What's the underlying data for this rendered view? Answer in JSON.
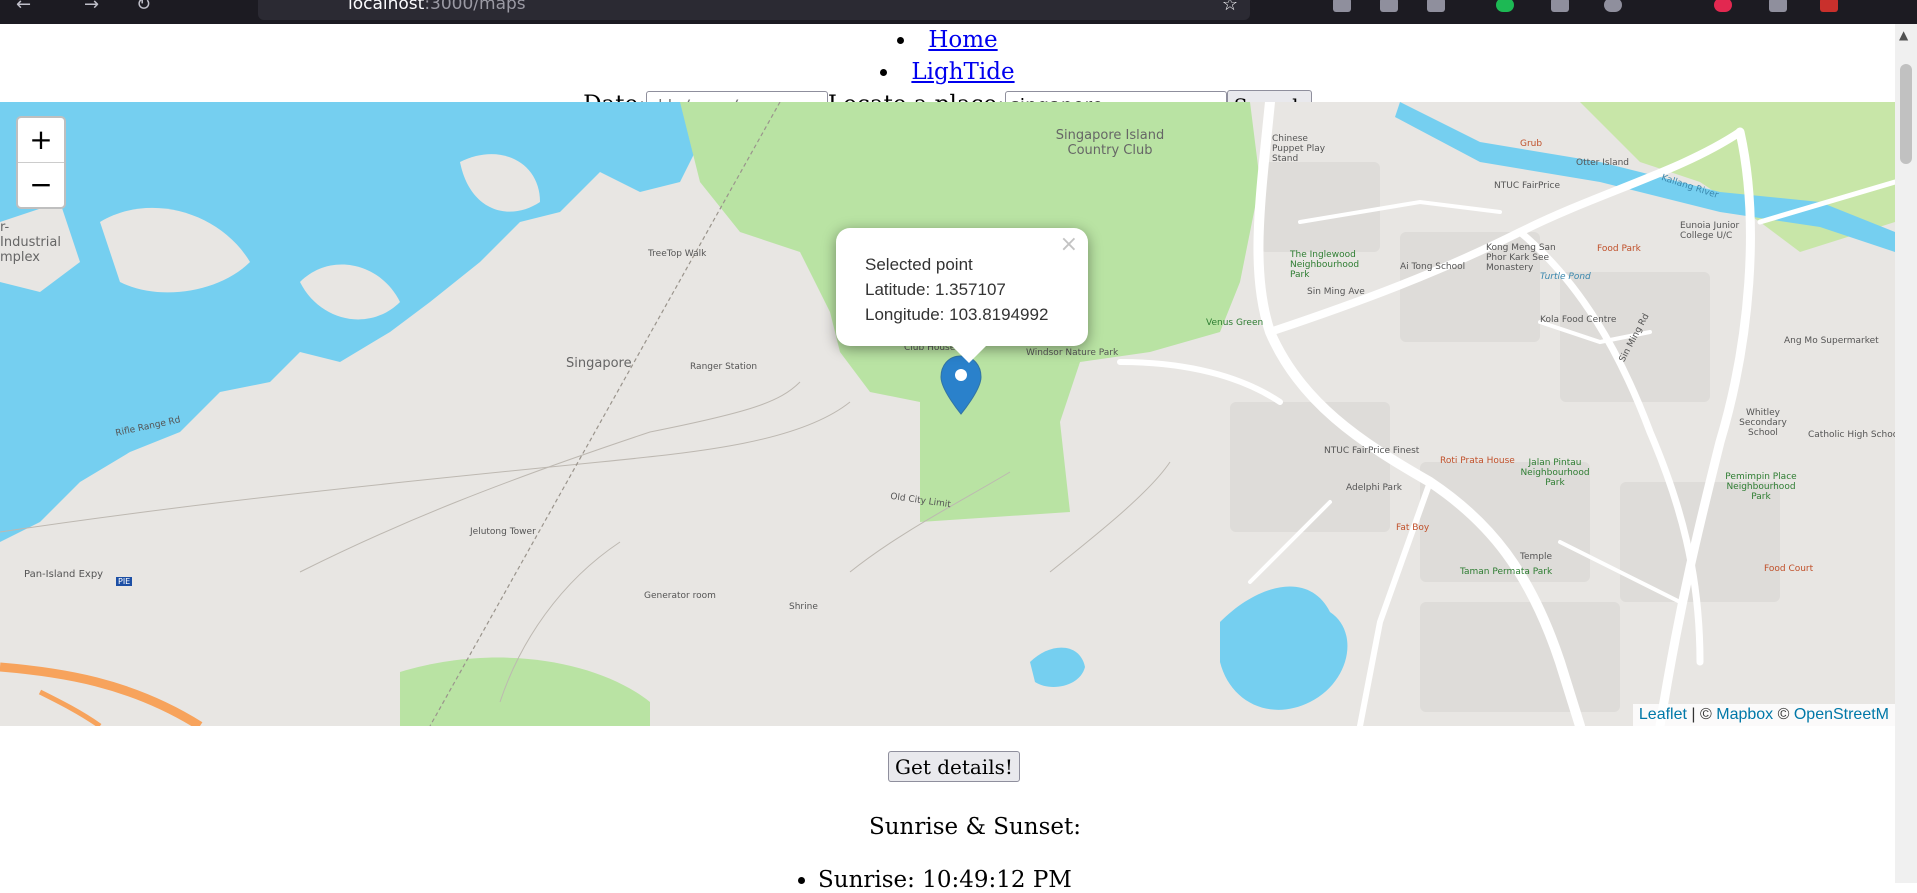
{
  "browser": {
    "back_glyph": "←",
    "forward_glyph": "→",
    "reload_glyph": "↻",
    "url_host": "localhost",
    "url_rest": ":3000/maps",
    "bookmark_glyph": "☆"
  },
  "nav": {
    "items": [
      {
        "label": "Home"
      },
      {
        "label": "LighTide"
      }
    ]
  },
  "controls": {
    "date_label": "Date:",
    "date_placeholder": "dd / mm / yyyy",
    "place_label": "Locate a place:",
    "place_value": "singapore",
    "search_label": "Search"
  },
  "map": {
    "zoom_in": "+",
    "zoom_out": "−",
    "popup": {
      "title": "Selected point",
      "latitude_line": "Latitude: 1.357107",
      "longitude_line": "Longitude: 103.8194992",
      "close": "×"
    },
    "attribution": {
      "leaflet": "Leaflet",
      "sep1": " | © ",
      "mapbox": "Mapbox",
      "sep2": " © ",
      "osm": "OpenStreetM"
    },
    "labels": {
      "singapore_island_cc": "Singapore Island Country Club",
      "singapore": "Singapore",
      "treetop_walk": "TreeTop Walk",
      "ranger_station": "Ranger Station",
      "club_house": "Club House",
      "windsor_park": "Windsor Nature Park",
      "venus_green": "Venus Green",
      "sin_ming_ave": "Sin Ming Ave",
      "inglewood_park": "The Inglewood Neighbourhood Park",
      "ai_tong_school": "Ai Tong School",
      "kong_meng": "Kong Meng San Phor Kark See Monastery",
      "ntuc_fairprice": "NTUC FairPrice",
      "eunoia": "Eunoia Junior College U/C",
      "kolla_food": "Kola Food Centre",
      "sin_ming_rd": "Sin Ming Rd",
      "jelutong_tower": "Jelutong Tower",
      "pan_island": "Pan-Island Expy",
      "pie": "PIE",
      "old_city_limit": "Old City Limit",
      "rifle_range": "Rifle Range Rd",
      "generator_room": "Generator room",
      "shrine": "Shrine",
      "industrial": "r-Industrial mplex",
      "whitley": "Whitley Secondary School",
      "catholic_high": "Catholic High School",
      "ang_mo": "Ang Mo Supermarket",
      "jalan_pintau": "Jalan Pintau Neighbourhood Park",
      "pemimpin": "Pemimpin Place Neighbourhood Park",
      "roti_prata": "Roti Prata House",
      "adelphi": "Adelphi Park",
      "taman_permata": "Taman Permata Park",
      "fat_boy": "Fat Boy",
      "temple": "Temple",
      "food_court": "Food Court",
      "kallang_river": "Kallang River",
      "food_park": "Food Park",
      "turtle_pond": "Turtle Pond",
      "ntuc_fairprice_finest": "NTUC FairPrice Finest",
      "chinese_puppet": "Chinese Puppet Play Stand",
      "otter_island": "Otter Island",
      "grub": "Grub"
    }
  },
  "details": {
    "button": "Get details!",
    "heading": "Sunrise & Sunset:",
    "sunrise": "Sunrise: 10:49:12 PM"
  },
  "colors": {
    "water": "#75cff0",
    "park": "#c8e6a8",
    "land": "#e8e6e3",
    "road": "#ffffff",
    "motorway": "#f7a35c",
    "marker": "#2a81cb",
    "link": "#0000ee"
  }
}
